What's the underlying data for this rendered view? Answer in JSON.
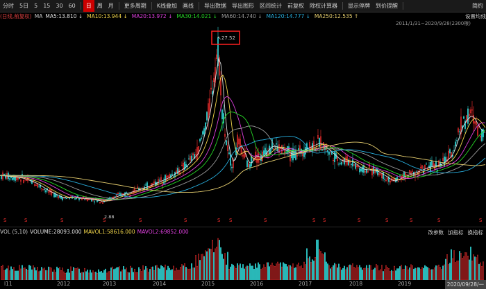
{
  "toolbar": {
    "items": [
      "分时",
      "5日",
      "5",
      "15",
      "30",
      "60",
      "日",
      "周",
      "月",
      "更多周期",
      "K线叠加",
      "画线",
      "导出数据",
      "导出图形",
      "区间统计",
      "前复权",
      "除权计算器",
      "显示停牌",
      "到价提醒"
    ],
    "active_index": 6,
    "right_label": "简约"
  },
  "ma_row": {
    "prefix": "(日线,前复权)",
    "ma_label": "MA",
    "items": [
      {
        "label": "MA5:13.810",
        "color": "#e0e0e0"
      },
      {
        "label": "MA10:13.944",
        "color": "#f2d64b"
      },
      {
        "label": "MA20:13.972",
        "color": "#e040e0"
      },
      {
        "label": "MA30:14.021",
        "color": "#26d826"
      },
      {
        "label": "MA60:14.740",
        "color": "#9a9a9a"
      },
      {
        "label": "MA120:14.777",
        "color": "#28b0e0"
      },
      {
        "label": "MA250:12.535",
        "color": "#e8d070"
      }
    ],
    "settings_label": "设置均线",
    "date_range": "2011/1/31~2020/9/28(2300根)"
  },
  "price_chart": {
    "high_label": "27.52",
    "low_label": "2.88",
    "marker": "S"
  },
  "volume": {
    "title": "VOL (5,10)",
    "volume": "VOLUME:28093.000",
    "mavol1": "MAVOL1:58616.000",
    "mavol2": "MAVOL2:69852.000",
    "buttons": [
      "改参数",
      "加指标",
      "换指标"
    ],
    "colors": {
      "volume": "#e0e0e0",
      "mavol1": "#f2d64b",
      "mavol2": "#e040e0"
    }
  },
  "xaxis": {
    "labels": [
      "l11",
      "2012",
      "2013",
      "2014",
      "2015",
      "2016",
      "2017",
      "2018",
      "2019"
    ],
    "end_date": "2020/09/28/一"
  },
  "chart_data": {
    "type": "line",
    "title": "",
    "x": [
      "2011",
      "2012",
      "2013",
      "2014",
      "2015",
      "2016",
      "2017",
      "2018",
      "2019",
      "2020"
    ],
    "series": [
      {
        "name": "MA250",
        "values": [
          6.5,
          5.0,
          3.5,
          4.5,
          10.0,
          11.0,
          11.5,
          8.5,
          7.0,
          12.5
        ]
      }
    ],
    "price_close": [
      7.0,
      4.8,
      3.0,
      5.0,
      26.0,
      10.5,
      12.0,
      9.0,
      6.5,
      14.0
    ],
    "annotations": [
      "27.52",
      "2.88"
    ],
    "ylim": [
      0,
      30
    ]
  }
}
